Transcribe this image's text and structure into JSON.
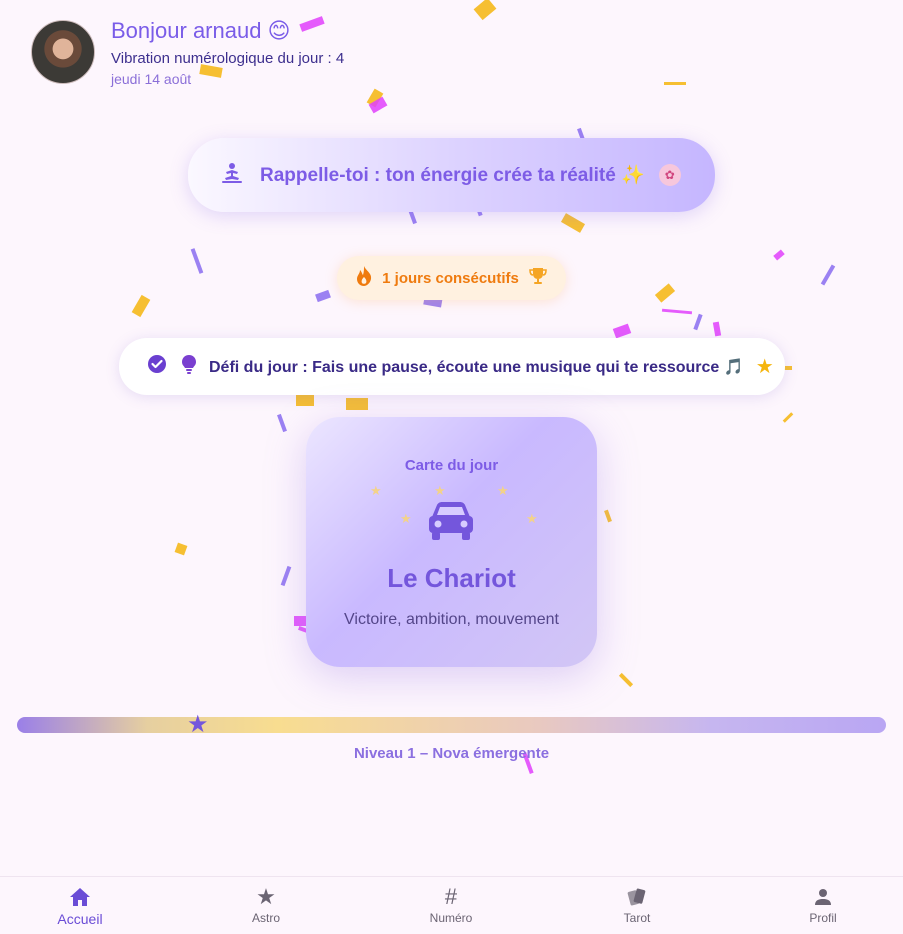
{
  "header": {
    "greeting": "Bonjour arnaud 😊",
    "vibration": "Vibration numérologique du jour : 4",
    "date": "jeudi 14 août"
  },
  "reminder": {
    "text": "Rappelle-toi : ton énergie crée ta réalité ✨",
    "icon": "meditation-icon"
  },
  "streak": {
    "text": "1 jours consécutifs"
  },
  "challenge": {
    "text": "Défi du jour : Fais une pause, écoute une musique qui te ressource 🎵"
  },
  "card": {
    "label": "Carte du jour",
    "name": "Le Chariot",
    "description": "Victoire, ambition, mouvement",
    "icon": "car-icon"
  },
  "level": {
    "label": "Niveau 1 – Nova émergente",
    "progress": 0.21
  },
  "nav": [
    {
      "label": "Accueil",
      "icon": "home-icon",
      "active": true
    },
    {
      "label": "Astro",
      "icon": "star-icon"
    },
    {
      "label": "Numéro",
      "icon": "hash-icon"
    },
    {
      "label": "Tarot",
      "icon": "cards-icon"
    },
    {
      "label": "Profil",
      "icon": "person-icon"
    }
  ],
  "colors": {
    "accent": "#7456dc",
    "streak": "#ef7b0f",
    "background": "#fdf6fd"
  }
}
